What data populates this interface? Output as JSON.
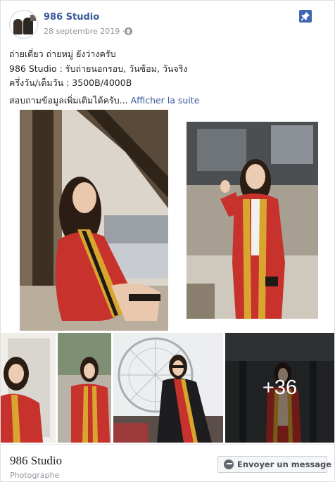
{
  "header": {
    "page_name": "986 Studio",
    "date": "28 septembre 2019 ·",
    "privacy_icon": "globe-icon",
    "pin_icon": "pin-icon"
  },
  "post": {
    "lines": [
      "ถ่ายเดี่ยว ถ่ายหมู่ ยังว่างครับ",
      "986 Studio : รับถ่ายนอกรอบ, วันซ้อม, วันจริง",
      "ครึ่งวัน/เต็มวัน : 3500B/4000B"
    ],
    "last_line": "สอบถามข้อมูลเพิ่มเติมได้ครับ...",
    "see_more": "Afficher la suite"
  },
  "photos": {
    "more_count": "+36"
  },
  "footer": {
    "page_name": "986 Studio",
    "category": "Photographe",
    "message_button": "Envoyer un message",
    "message_icon": "messenger-icon"
  },
  "colors": {
    "link": "#385898",
    "meta": "#90949c",
    "pin_bg": "#4267b2",
    "gown_red": "#c8322c",
    "stole_gold": "#d8a62e"
  }
}
